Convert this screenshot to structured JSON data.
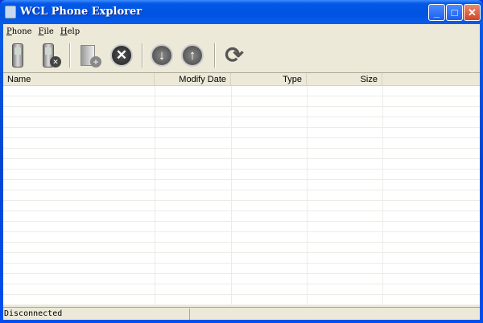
{
  "window": {
    "title": "WCL Phone Explorer",
    "minimize": "_",
    "maximize": "□",
    "close": "✕"
  },
  "menu": [
    "Phone",
    "File",
    "Help"
  ],
  "toolbar": [
    {
      "name": "connect-phone",
      "icon": "phone-icon"
    },
    {
      "name": "disconnect-phone",
      "icon": "phone-disconnect-icon"
    },
    {
      "name": "new-folder",
      "icon": "folder-add-icon"
    },
    {
      "name": "delete",
      "icon": "delete-icon",
      "glyph": "✕"
    },
    {
      "name": "download",
      "icon": "download-icon",
      "glyph": "↓"
    },
    {
      "name": "upload",
      "icon": "upload-icon",
      "glyph": "↑"
    },
    {
      "name": "refresh",
      "icon": "refresh-icon",
      "glyph": "⟳"
    }
  ],
  "columns": [
    "Name",
    "Modify Date",
    "Type",
    "Size"
  ],
  "rows": [],
  "status": {
    "text": "Disconnected"
  }
}
